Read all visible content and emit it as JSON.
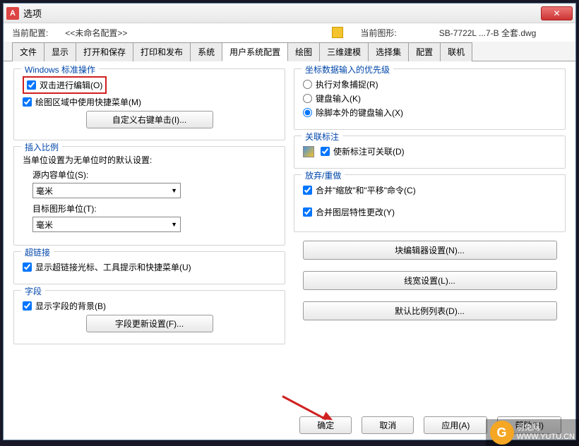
{
  "window": {
    "title": "选项"
  },
  "infobar": {
    "profile_label": "当前配置:",
    "profile_value": "<<未命名配置>>",
    "drawing_label": "当前图形:",
    "drawing_value": "SB-7722L ...7-B 全套.dwg"
  },
  "tabs": [
    "文件",
    "显示",
    "打开和保存",
    "打印和发布",
    "系统",
    "用户系统配置",
    "绘图",
    "三维建模",
    "选择集",
    "配置",
    "联机"
  ],
  "active_tab": "用户系统配置",
  "left": {
    "windows_group": "Windows 标准操作",
    "dblclick_edit": "双击进行编辑(O)",
    "shortcut_menu": "绘图区域中使用快捷菜单(M)",
    "right_click_btn": "自定义右键单击(I)...",
    "insert_scale_group": "插入比例",
    "insert_note": "当单位设置为无单位时的默认设置:",
    "source_label": "源内容单位(S):",
    "source_value": "毫米",
    "target_label": "目标图形单位(T):",
    "target_value": "毫米",
    "hyperlink_group": "超链接",
    "hyperlink_chk": "显示超链接光标、工具提示和快捷菜单(U)",
    "field_group": "字段",
    "field_chk": "显示字段的背景(B)",
    "field_btn": "字段更新设置(F)..."
  },
  "right": {
    "priority_group": "坐标数据输入的优先级",
    "opt1": "执行对象捕捉(R)",
    "opt2": "键盘输入(K)",
    "opt3": "除脚本外的键盘输入(X)",
    "assoc_group": "关联标注",
    "assoc_chk": "使新标注可关联(D)",
    "undo_group": "放弃/重做",
    "undo_chk1": "合并\"缩放\"和\"平移\"命令(C)",
    "undo_chk2": "合并图层特性更改(Y)",
    "btn1": "块编辑器设置(N)...",
    "btn2": "线宽设置(L)...",
    "btn3": "默认比例列表(D)..."
  },
  "footer": {
    "ok": "确定",
    "cancel": "取消",
    "apply": "应用(A)",
    "help": "帮助(H)"
  },
  "watermark": {
    "brand": "羽兔网",
    "url": "WWW.YUTU.CN"
  }
}
